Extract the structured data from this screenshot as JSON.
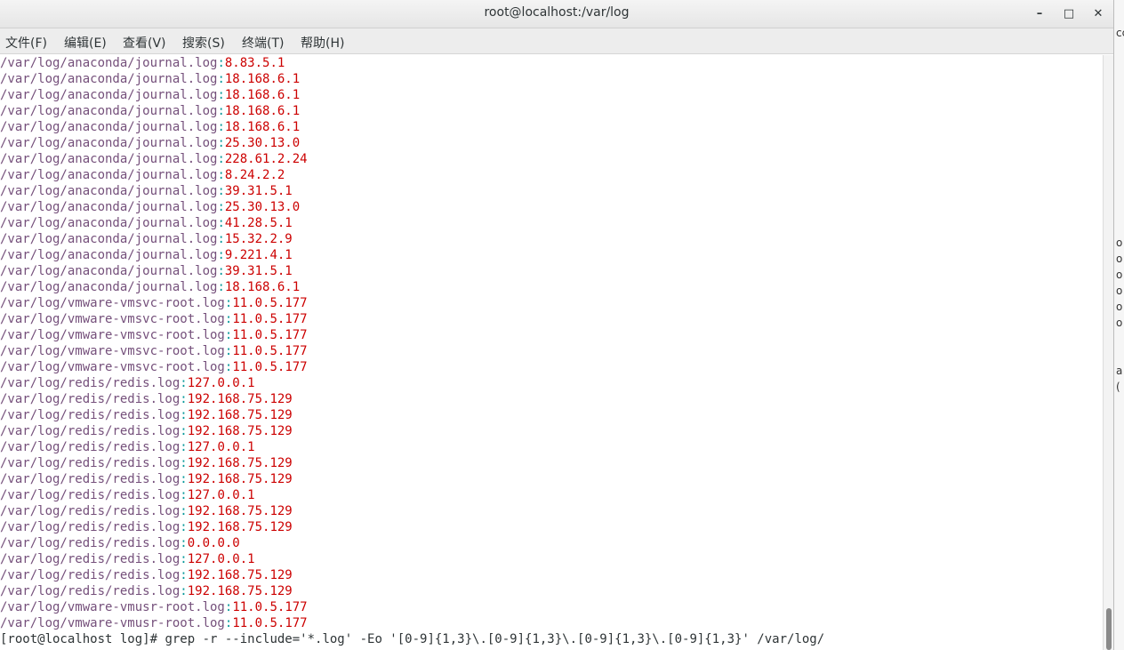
{
  "window": {
    "title": "root@localhost:/var/log"
  },
  "window_controls": {
    "minimize": "–",
    "maximize": "□",
    "close": "✕"
  },
  "menu": [
    {
      "label": "文件(F)"
    },
    {
      "label": "编辑(E)"
    },
    {
      "label": "查看(V)"
    },
    {
      "label": "搜索(S)"
    },
    {
      "label": "终端(T)"
    },
    {
      "label": "帮助(H)"
    }
  ],
  "output": [
    {
      "path": "/var/log/anaconda/journal.log",
      "ip": "8.83.5.1"
    },
    {
      "path": "/var/log/anaconda/journal.log",
      "ip": "18.168.6.1"
    },
    {
      "path": "/var/log/anaconda/journal.log",
      "ip": "18.168.6.1"
    },
    {
      "path": "/var/log/anaconda/journal.log",
      "ip": "18.168.6.1"
    },
    {
      "path": "/var/log/anaconda/journal.log",
      "ip": "18.168.6.1"
    },
    {
      "path": "/var/log/anaconda/journal.log",
      "ip": "25.30.13.0"
    },
    {
      "path": "/var/log/anaconda/journal.log",
      "ip": "228.61.2.24"
    },
    {
      "path": "/var/log/anaconda/journal.log",
      "ip": "8.24.2.2"
    },
    {
      "path": "/var/log/anaconda/journal.log",
      "ip": "39.31.5.1"
    },
    {
      "path": "/var/log/anaconda/journal.log",
      "ip": "25.30.13.0"
    },
    {
      "path": "/var/log/anaconda/journal.log",
      "ip": "41.28.5.1"
    },
    {
      "path": "/var/log/anaconda/journal.log",
      "ip": "15.32.2.9"
    },
    {
      "path": "/var/log/anaconda/journal.log",
      "ip": "9.221.4.1"
    },
    {
      "path": "/var/log/anaconda/journal.log",
      "ip": "39.31.5.1"
    },
    {
      "path": "/var/log/anaconda/journal.log",
      "ip": "18.168.6.1"
    },
    {
      "path": "/var/log/vmware-vmsvc-root.log",
      "ip": "11.0.5.177"
    },
    {
      "path": "/var/log/vmware-vmsvc-root.log",
      "ip": "11.0.5.177"
    },
    {
      "path": "/var/log/vmware-vmsvc-root.log",
      "ip": "11.0.5.177"
    },
    {
      "path": "/var/log/vmware-vmsvc-root.log",
      "ip": "11.0.5.177"
    },
    {
      "path": "/var/log/vmware-vmsvc-root.log",
      "ip": "11.0.5.177"
    },
    {
      "path": "/var/log/redis/redis.log",
      "ip": "127.0.0.1"
    },
    {
      "path": "/var/log/redis/redis.log",
      "ip": "192.168.75.129"
    },
    {
      "path": "/var/log/redis/redis.log",
      "ip": "192.168.75.129"
    },
    {
      "path": "/var/log/redis/redis.log",
      "ip": "192.168.75.129"
    },
    {
      "path": "/var/log/redis/redis.log",
      "ip": "127.0.0.1"
    },
    {
      "path": "/var/log/redis/redis.log",
      "ip": "192.168.75.129"
    },
    {
      "path": "/var/log/redis/redis.log",
      "ip": "192.168.75.129"
    },
    {
      "path": "/var/log/redis/redis.log",
      "ip": "127.0.0.1"
    },
    {
      "path": "/var/log/redis/redis.log",
      "ip": "192.168.75.129"
    },
    {
      "path": "/var/log/redis/redis.log",
      "ip": "192.168.75.129"
    },
    {
      "path": "/var/log/redis/redis.log",
      "ip": "0.0.0.0"
    },
    {
      "path": "/var/log/redis/redis.log",
      "ip": "127.0.0.1"
    },
    {
      "path": "/var/log/redis/redis.log",
      "ip": "192.168.75.129"
    },
    {
      "path": "/var/log/redis/redis.log",
      "ip": "192.168.75.129"
    },
    {
      "path": "/var/log/vmware-vmusr-root.log",
      "ip": "11.0.5.177"
    },
    {
      "path": "/var/log/vmware-vmusr-root.log",
      "ip": "11.0.5.177"
    }
  ],
  "separator": ":",
  "prompt": {
    "text": "[root@localhost log]# ",
    "command": "grep -r --include='*.log' -Eo '[0-9]{1,3}\\.[0-9]{1,3}\\.[0-9]{1,3}\\.[0-9]{1,3}' /var/log/"
  },
  "background_window": {
    "chars": [
      "cc",
      "o",
      "o",
      "o",
      "o",
      "o",
      "o",
      "a",
      "("
    ]
  },
  "colors": {
    "path": "#75507b",
    "ip": "#cc0000",
    "text": "#2e3436"
  },
  "scroll": {
    "thumb_top_fraction": 0.93,
    "thumb_size_fraction": 0.07
  }
}
